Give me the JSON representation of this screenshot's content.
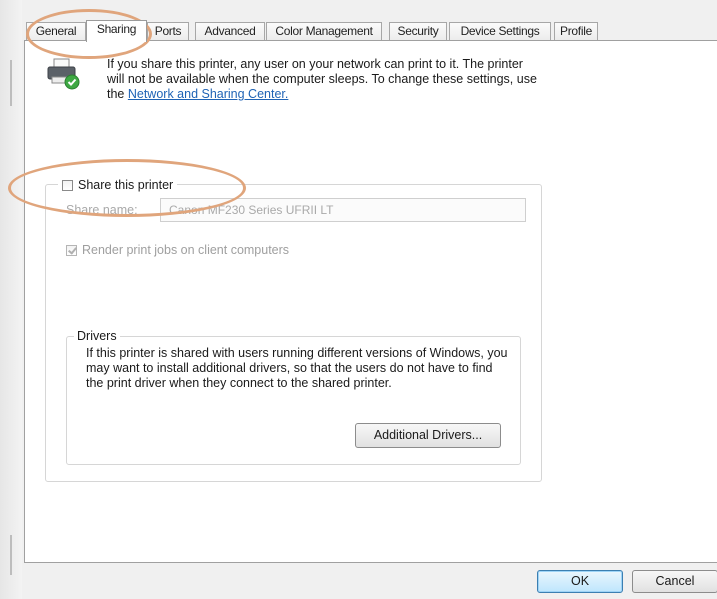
{
  "tabs": [
    {
      "label": "General",
      "active": false
    },
    {
      "label": "Sharing",
      "active": true
    },
    {
      "label": "Ports",
      "active": false
    },
    {
      "label": "Advanced",
      "active": false
    },
    {
      "label": "Color Management",
      "active": false
    },
    {
      "label": "Security",
      "active": false
    },
    {
      "label": "Device Settings",
      "active": false
    },
    {
      "label": "Profile",
      "active": false
    }
  ],
  "intro": {
    "text": "If you share this printer, any user on your network can print to it. The printer will not be available when the computer sleeps. To change these settings, use the ",
    "link": "Network and Sharing Center."
  },
  "share": {
    "checkbox_label": "Share this printer",
    "checked": false,
    "share_name_label": "Share name:",
    "share_name_value": "Canon MF230 Series UFRII LT"
  },
  "render": {
    "label": "Render print jobs on client computers",
    "checked": true,
    "disabled": true
  },
  "drivers": {
    "title": "Drivers",
    "text": "If this printer is shared with users running different versions of Windows, you may want to install additional drivers, so that the users do not have to find the print driver when they connect to the shared printer.",
    "button": "Additional Drivers..."
  },
  "footer": {
    "ok": "OK",
    "cancel": "Cancel"
  },
  "icons": {
    "printer": "printer-share-icon",
    "check": "check-icon"
  },
  "colors": {
    "link": "#1f63b5",
    "highlight": "#e0a57c",
    "disabled_text": "#a9a9a9"
  }
}
